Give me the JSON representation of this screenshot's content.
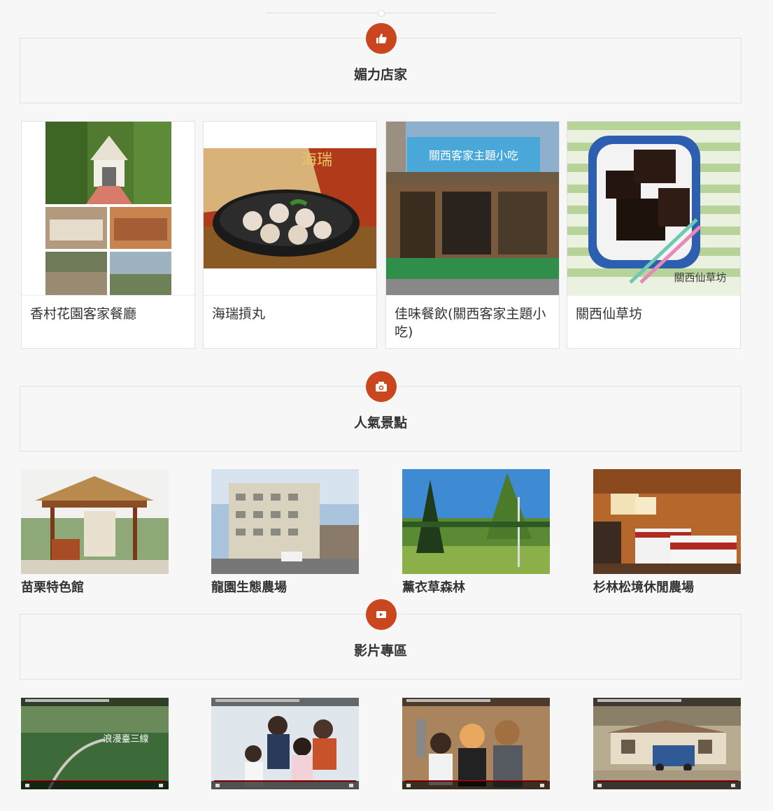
{
  "sections": {
    "shops": {
      "title": "媚力店家"
    },
    "spots": {
      "title": "人氣景點"
    },
    "videos": {
      "title": "影片專區"
    }
  },
  "shops": [
    {
      "name": "香村花園客家餐廳"
    },
    {
      "name": "海瑞摃丸"
    },
    {
      "name": "佳味餐飲(關西客家主題小吃)"
    },
    {
      "name": "關西仙草坊"
    }
  ],
  "shop_images": {
    "signboard": "關西客家主題小吃",
    "watermark": "關西仙草坊",
    "bowl_text": "海瑞"
  },
  "spots": [
    {
      "name": "苗栗特色館"
    },
    {
      "name": "龍園生態農場"
    },
    {
      "name": "薰衣草森林"
    },
    {
      "name": "杉林松境休閒農場"
    }
  ],
  "video_images": {
    "overlay_text": "浪漫臺三線"
  },
  "colors": {
    "accent": "#c9461f",
    "border": "#e2e2e2",
    "background": "#f7f7f7"
  },
  "icons": {
    "shops": "thumbs-up-icon",
    "spots": "camera-icon",
    "videos": "video-icon"
  }
}
